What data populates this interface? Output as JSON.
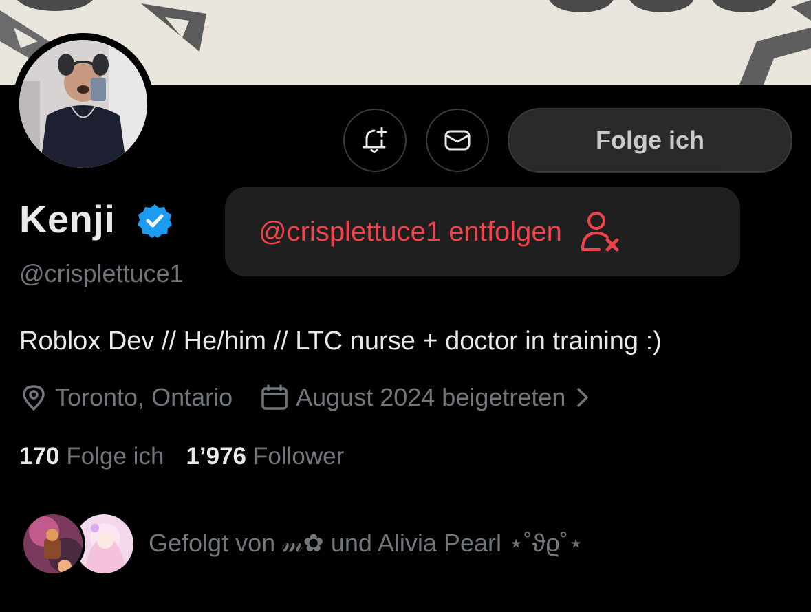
{
  "profile": {
    "name": "Kenji",
    "handle": "@crisplettuce1",
    "bio": "Roblox Dev // He/him // LTC nurse + doctor in training :)",
    "location": "Toronto, Ontario",
    "joined": "August 2024 beigetreten",
    "following_count": "170",
    "following_label": "Folge ich",
    "followers_count": "1’976",
    "followers_label": "Follower",
    "followed_by": "Gefolgt von 𝓂✿ und Alivia Pearl ⋆˚ϑϱ˚⋆"
  },
  "actions": {
    "follow_label": "Folge ich",
    "bell_icon": "bell-plus-icon",
    "message_icon": "envelope-icon"
  },
  "popup": {
    "label": "@crisplettuce1 entfolgen",
    "icon": "person-x-icon"
  },
  "colors": {
    "background": "#000000",
    "text": "#e7e9ea",
    "muted": "#71767b",
    "verified": "#1d9bf0",
    "danger": "#f4424c",
    "popup_bg": "#1f1f1f",
    "button_bg": "#2a2a2a"
  }
}
